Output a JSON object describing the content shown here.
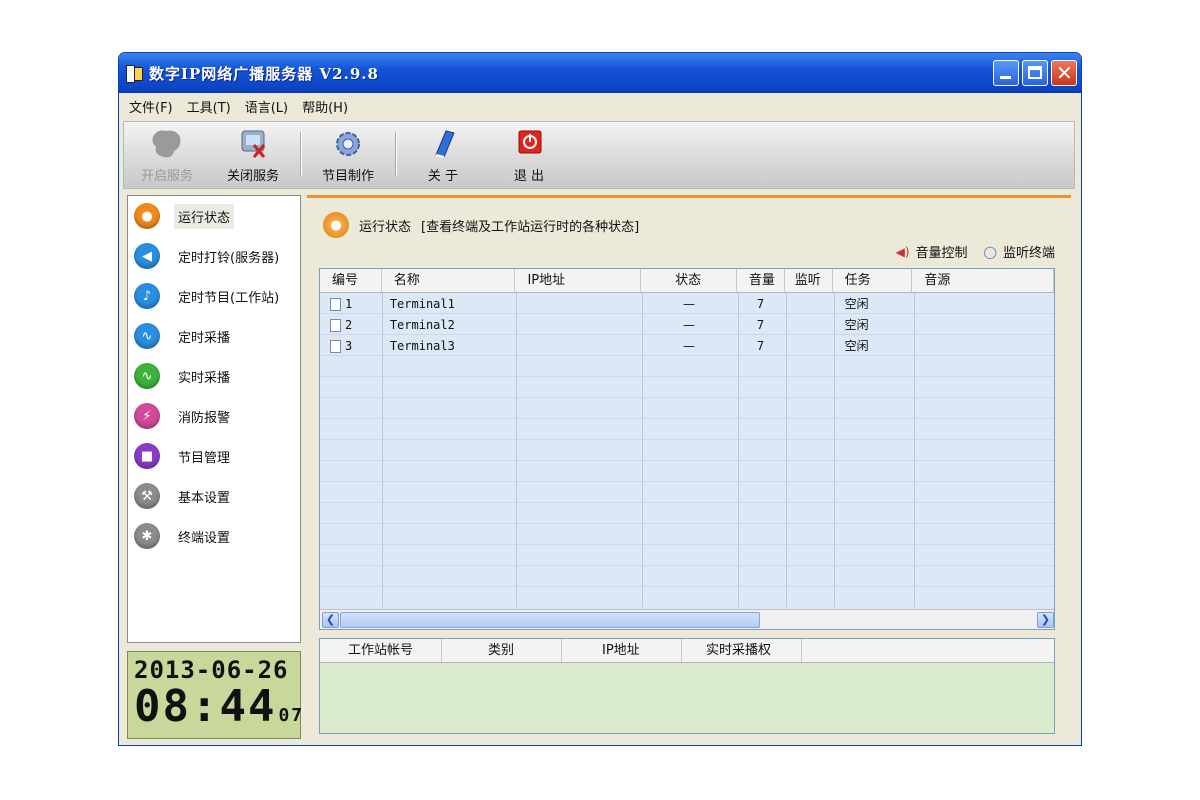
{
  "window": {
    "title": "数字IP网络广播服务器 V2.9.8"
  },
  "menu": [
    "文件(F)",
    "工具(T)",
    "语言(L)",
    "帮助(H)"
  ],
  "toolbar": {
    "start": "开启服务",
    "stop": "关闭服务",
    "program": "节目制作",
    "about": "关 于",
    "exit": "退 出"
  },
  "nav": [
    {
      "label": "运行状态",
      "color": "#f08a1c",
      "icon": "user-icon"
    },
    {
      "label": "定时打铃(服务器)",
      "color": "#2a8fe0",
      "icon": "speaker-icon"
    },
    {
      "label": "定时节目(工作站)",
      "color": "#2a8fe0",
      "icon": "music-note-icon"
    },
    {
      "label": "定时采播",
      "color": "#2a8fe0",
      "icon": "waveform-icon"
    },
    {
      "label": "实时采播",
      "color": "#3cb43c",
      "icon": "waveform-icon"
    },
    {
      "label": "消防报警",
      "color": "#d24a9a",
      "icon": "lightning-icon"
    },
    {
      "label": "节目管理",
      "color": "#8a3cc8",
      "icon": "folder-icon"
    },
    {
      "label": "基本设置",
      "color": "#8c8c8c",
      "icon": "wrench-icon"
    },
    {
      "label": "终端设置",
      "color": "#8c8c8c",
      "icon": "asterisk-icon"
    }
  ],
  "clock": {
    "date": "2013-06-26",
    "time": "08:44",
    "seconds": "07"
  },
  "main": {
    "header_title": "运行状态",
    "header_desc": "[查看终端及工作站运行时的各种状态]",
    "volume_control": "音量控制",
    "monitor_terminal": "监听终端"
  },
  "terminals": {
    "columns": [
      "编号",
      "名称",
      "IP地址",
      "状态",
      "音量",
      "监听",
      "任务",
      "音源"
    ],
    "rows": [
      {
        "id": "1",
        "name": "Terminal1",
        "ip": "",
        "status": "—",
        "volume": "7",
        "monitor": "",
        "task": "空闲",
        "source": ""
      },
      {
        "id": "2",
        "name": "Terminal2",
        "ip": "",
        "status": "—",
        "volume": "7",
        "monitor": "",
        "task": "空闲",
        "source": ""
      },
      {
        "id": "3",
        "name": "Terminal3",
        "ip": "",
        "status": "—",
        "volume": "7",
        "monitor": "",
        "task": "空闲",
        "source": ""
      }
    ]
  },
  "workstations": {
    "columns": [
      "工作站帐号",
      "类别",
      "IP地址",
      "实时采播权"
    ]
  }
}
